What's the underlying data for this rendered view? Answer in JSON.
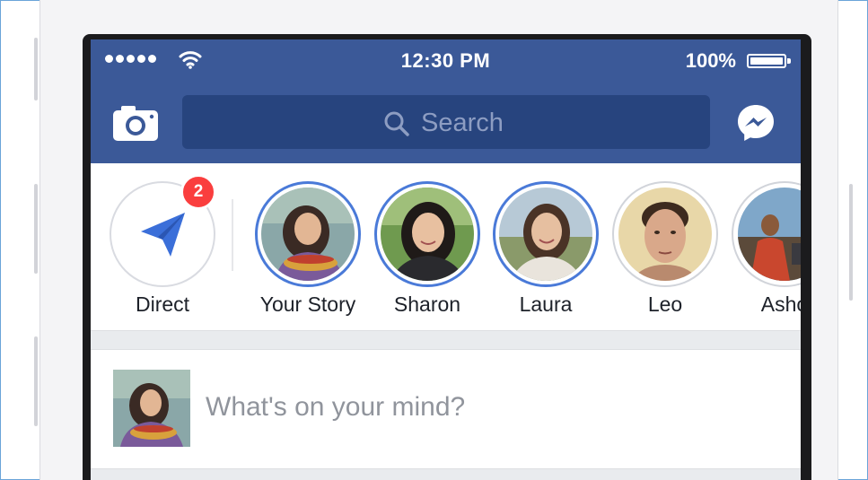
{
  "status_bar": {
    "time": "12:30 PM",
    "battery_percent": "100%",
    "signal_bars": 5,
    "wifi_icon": "wifi-icon",
    "battery_level": 1.0
  },
  "nav_bar": {
    "camera_icon": "camera-icon",
    "search_placeholder": "Search",
    "search_icon": "search-icon",
    "messenger_icon": "messenger-icon"
  },
  "stories": {
    "direct": {
      "label": "Direct",
      "badge_count": "2",
      "icon": "paper-plane-icon"
    },
    "items": [
      {
        "label": "Your Story",
        "ring": "active"
      },
      {
        "label": "Sharon",
        "ring": "active"
      },
      {
        "label": "Laura",
        "ring": "active"
      },
      {
        "label": "Leo",
        "ring": "seen"
      },
      {
        "label": "Asho",
        "ring": "seen"
      }
    ]
  },
  "composer": {
    "placeholder": "What's on your mind?"
  },
  "colors": {
    "brand_blue": "#3b5998",
    "search_bg": "#27447e",
    "story_ring_active": "#4a7ad8",
    "badge_red": "#fa3e3e"
  }
}
